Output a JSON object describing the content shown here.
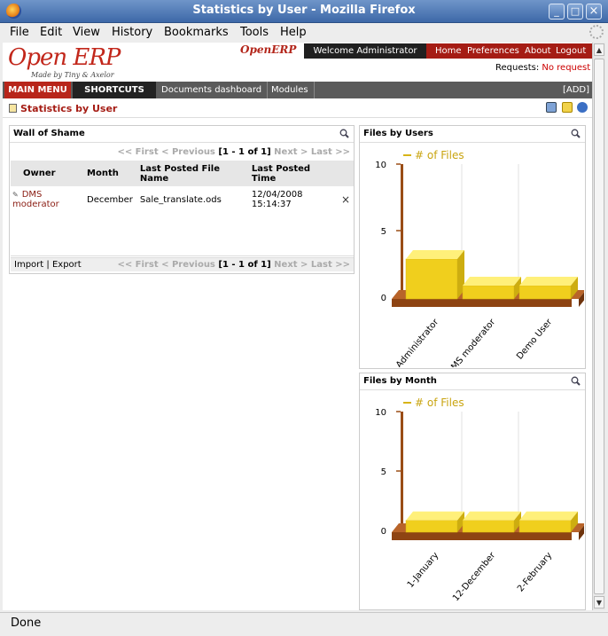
{
  "window": {
    "title": "Statistics by User - Mozilla Firefox",
    "min": "_",
    "max": "□",
    "close": "×"
  },
  "menus": [
    "File",
    "Edit",
    "View",
    "History",
    "Bookmarks",
    "Tools",
    "Help"
  ],
  "status": "Done",
  "header": {
    "logo_top": "Open ERP",
    "logo_sub": "Made by Tiny & Axelor",
    "logo_small": "OpenERP",
    "welcome": "Welcome Administrator",
    "links": [
      "Home",
      "Preferences",
      "About",
      "Logout"
    ],
    "requests_label": "Requests:",
    "requests_value": "No request"
  },
  "nav": {
    "main_menu": "MAIN MENU",
    "shortcuts": "SHORTCUTS",
    "items": [
      "Documents dashboard",
      "Modules"
    ],
    "add": "[ADD]"
  },
  "page": {
    "title": "Statistics by User"
  },
  "wall": {
    "title": "Wall of Shame",
    "pager": {
      "first": "<< First",
      "prev": "< Previous",
      "range": "[1 - 1 of 1]",
      "next": "Next >",
      "last": "Last >>"
    },
    "columns": [
      "Owner",
      "Month",
      "Last Posted File Name",
      "Last Posted Time"
    ],
    "rows": [
      {
        "owner": "DMS moderator",
        "month": "December",
        "file": "Sale_translate.ods",
        "time": "12/04/2008 15:14:37"
      }
    ],
    "footer": {
      "import": "Import",
      "sep": "|",
      "export": "Export"
    }
  },
  "colors": {
    "accent": "#a51c14",
    "bar": "#f3d21c",
    "base": "#a0501a"
  },
  "chart_data": [
    {
      "type": "bar",
      "title": "Files by Users",
      "legend": "# of Files",
      "categories": [
        "Administrator",
        "DMS moderator",
        "Demo User"
      ],
      "values": [
        3,
        1,
        1
      ],
      "ylim": [
        0,
        10
      ],
      "yticks": [
        0,
        5,
        10
      ]
    },
    {
      "type": "bar",
      "title": "Files by Month",
      "legend": "# of Files",
      "categories": [
        "1-January",
        "12-December",
        "2-February"
      ],
      "values": [
        1,
        1,
        1
      ],
      "ylim": [
        0,
        10
      ],
      "yticks": [
        0,
        5,
        10
      ]
    }
  ]
}
